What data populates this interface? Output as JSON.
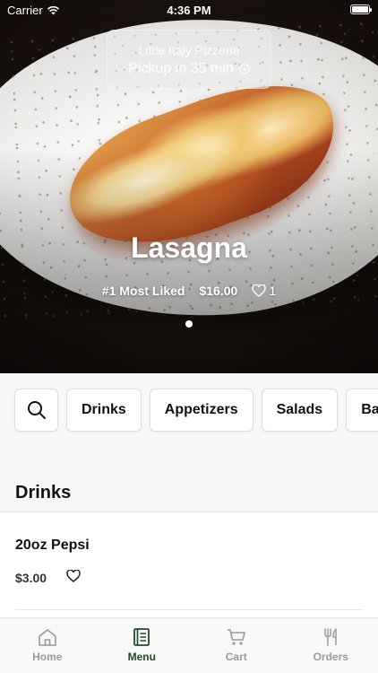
{
  "status_bar": {
    "carrier": "Carrier",
    "time": "4:36 PM"
  },
  "hero": {
    "restaurant_name": "Little Italy Pizzeria",
    "pickup_text": "Pickup in 35 min",
    "dish_name": "Lasagna",
    "badge": "#1 Most Liked",
    "price": "$16.00",
    "likes": "1",
    "slide_count": 1,
    "active_slide": 1
  },
  "categories": {
    "search_icon": "search-icon",
    "items": [
      "Drinks",
      "Appetizers",
      "Salads",
      "Ba"
    ]
  },
  "section": {
    "title": "Drinks"
  },
  "menu_items": [
    {
      "name": "20oz Pepsi",
      "price": "$3.00",
      "favorite_icon": "heart-outline-icon"
    }
  ],
  "tab_bar": {
    "tabs": [
      {
        "label": "Home",
        "icon": "home-icon",
        "active": false
      },
      {
        "label": "Menu",
        "icon": "menu-book-icon",
        "active": true
      },
      {
        "label": "Cart",
        "icon": "cart-icon",
        "active": false
      },
      {
        "label": "Orders",
        "icon": "fork-knife-icon",
        "active": false
      }
    ]
  },
  "colors": {
    "accent": "#1f4b2a",
    "inactive_tab": "#9a9a9a",
    "background": "#f7f7f7"
  }
}
